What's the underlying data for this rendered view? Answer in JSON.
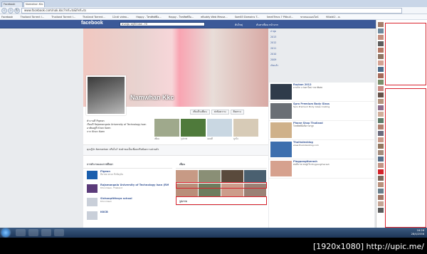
{
  "browser": {
    "tabs": [
      {
        "label": "Facebook"
      },
      {
        "label": "Namwhan Kkc",
        "active": true
      }
    ],
    "url": "www.facebook.com/nak.kkc?ref=ts&fref=ts",
    "bookmarks": [
      "Facebook",
      "Thailand Torrent I...",
      "Thailand Torrent I...",
      "Thailand Torrent...",
      "12cdi video...",
      "Happy - โทรศัพท์มือ...",
      "Happy - โทรศัพท์มือ...",
      "eBuddy Web Messe...",
      "Sam83 Domains T...",
      "AmeliTrevs 7 Pitbull...",
      "ขายของออนไลน์",
      "Hillaidi2 - ค.",
      "หวังมหาวิทยาลัยตั้ง"
    ]
  },
  "fb": {
    "logo": "facebook",
    "search_value": "คนกลุ่ม จตุจักรเขต - Hi",
    "user": "ต้นไทยุ่",
    "links": "ค้นหาเพื่อน   หน้าแรก",
    "profile_name": "Namwhan Kkc",
    "actions": [
      "เพิ่มเป็นเพื่อน",
      "ส่งข้อความ",
      "ติดตาม"
    ],
    "info": [
      "ทำงานที่ Pigeon",
      "เรียนที่ Rajamangala University of Technology Isan",
      "อาศัยอยู่ที่ Khon Kaen",
      "จาก Khon Kaen"
    ],
    "thumb_labels": [
      "เพื่อน",
      "รูปภาพ",
      "แผนที่",
      "ถูกใจ"
    ],
    "status_line": "คุณรู้จัก Namwhan หรือไม่? ส่งคำขอเป็นเพื่อนหรือข้อความส่วนตัว",
    "about_header": "การทำงานและการศึกษา",
    "about": [
      {
        "title": "Pigeon",
        "sub": "มีนาคม 2012 ถึงปัจจุบัน"
      },
      {
        "title": "Rajamangala University of Technology Isan (RMUTI)",
        "sub": "Khon Kaen, Thailand"
      },
      {
        "title": "Sichonpitthaya school",
        "sub": "Khon Kaen"
      },
      {
        "title": "KKCB",
        "sub": ""
      }
    ],
    "friends_header": "เพื่อน",
    "photos_header": "รูปภาพ",
    "timeline": [
      "ล่าสุด",
      "2013",
      "2012",
      "2011",
      "2010",
      "2009",
      "เกิดแล้ว"
    ],
    "ads": [
      {
        "title": "Rayban 2012",
        "desc": "มาแล้ว! แว่นตาใหม่ ราคาพิเศษ"
      },
      {
        "title": "Spro Premium Body Glass",
        "desc": "Spro Premium Body Glass Coating"
      },
      {
        "title": "Phone Shop Thailand",
        "desc": "โทรศัพท์มือถือราคาถูก"
      },
      {
        "title": "Thaiindexblog",
        "desc": "www.thaiindexblog.com"
      },
      {
        "title": "Pingpangtherash",
        "desc": "คนอื่น 59 คนถูกใจ Pingpangtherash"
      }
    ]
  },
  "taskbar": {
    "time": "16:26",
    "date": "28/4/2556"
  },
  "watermark": "[1920x1080] http://upic.me/"
}
